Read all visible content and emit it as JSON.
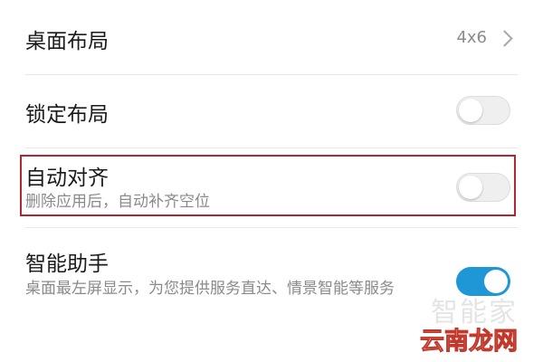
{
  "settings": {
    "layout": {
      "label": "桌面布局",
      "value": "4x6"
    },
    "lock_layout": {
      "label": "锁定布局",
      "enabled": false
    },
    "auto_align": {
      "label": "自动对齐",
      "description": "删除应用后，自动补齐空位",
      "enabled": false
    },
    "smart_assistant": {
      "label": "智能助手",
      "description": "桌面最左屏显示，为您提供服务直达、情景智能等服务",
      "enabled": true
    }
  },
  "watermark": {
    "line1": "智能家",
    "line2": "云南龙网"
  },
  "colors": {
    "toggle_on": "#1f97d6",
    "highlight_border": "#b3262d"
  }
}
